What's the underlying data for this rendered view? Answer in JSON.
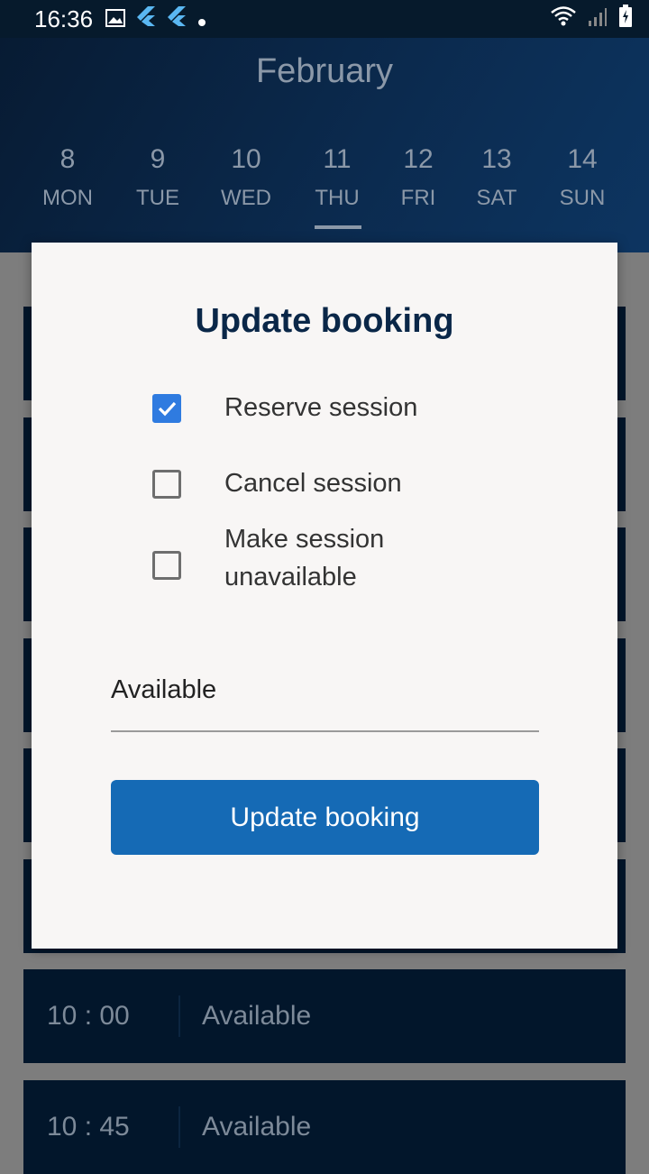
{
  "status_bar": {
    "time": "16:36",
    "left_icons": [
      "image-icon",
      "flutter-icon",
      "flutter-icon",
      "dot-icon"
    ],
    "right_icons": [
      "wifi-icon",
      "signal-icon",
      "battery-icon"
    ]
  },
  "header": {
    "month": "February",
    "days": [
      {
        "num": "8",
        "dow": "MON"
      },
      {
        "num": "9",
        "dow": "TUE"
      },
      {
        "num": "10",
        "dow": "WED"
      },
      {
        "num": "11",
        "dow": "THU",
        "selected": true
      },
      {
        "num": "12",
        "dow": "FRI"
      },
      {
        "num": "13",
        "dow": "SAT"
      },
      {
        "num": "14",
        "dow": "SUN"
      }
    ]
  },
  "slots": [
    {
      "time": "10 : 00",
      "status": "Available"
    },
    {
      "time": "10 : 45",
      "status": "Available"
    }
  ],
  "dialog": {
    "title": "Update booking",
    "options": [
      {
        "label": "Reserve session",
        "checked": true
      },
      {
        "label": "Cancel session",
        "checked": false
      },
      {
        "label": "Make session\nunavailable",
        "label_line1": "Make session",
        "label_line2": "unavailable",
        "checked": false
      }
    ],
    "status_field_value": "Available",
    "submit_label": "Update booking"
  },
  "colors": {
    "accent": "#156ab5",
    "checkbox_checked": "#2f7be0",
    "title": "#0a2748",
    "header_dark": "#071b33",
    "slot_bg": "#02162b"
  }
}
